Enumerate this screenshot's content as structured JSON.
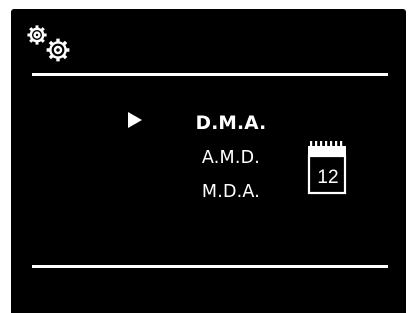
{
  "header": {
    "icon": "settings-gears-icon"
  },
  "menu": {
    "pointer_icon": "right-triangle-icon",
    "items": [
      {
        "label": "D.M.A.",
        "selected": true
      },
      {
        "label": "A.M.D.",
        "selected": false
      },
      {
        "label": "M.D.A.",
        "selected": false
      }
    ]
  },
  "calendar": {
    "icon": "calendar-icon",
    "day": "12"
  },
  "colors": {
    "background": "#000000",
    "foreground": "#ffffff"
  }
}
